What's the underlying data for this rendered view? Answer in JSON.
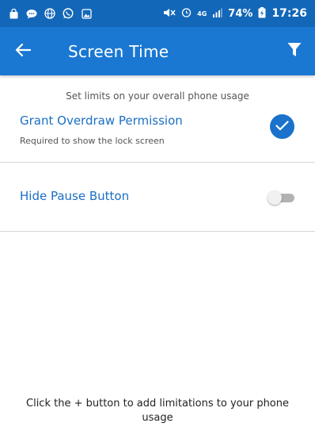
{
  "status_bar": {
    "battery_percent": "74%",
    "time": "17:26",
    "network": "4G",
    "left_icons": [
      "shopping-bag-icon",
      "message-icon",
      "globe-icon",
      "whatsapp-icon",
      "gallery-icon"
    ],
    "right_icons": [
      "mute-icon",
      "alarm-icon",
      "network-4g-icon",
      "signal-icon",
      "battery-charging-icon"
    ]
  },
  "app_bar": {
    "title": "Screen Time",
    "color": "#1a78d2",
    "left_icon": "back-arrow-icon",
    "right_icon": "filter-icon"
  },
  "settings": {
    "subtitle": "Set limits on your overall phone usage",
    "items": [
      {
        "title": "Grant Overdraw Permission",
        "subtitle": "Required to show the lock screen",
        "control": "check-icon",
        "checked": true
      },
      {
        "title": "Hide Pause Button",
        "control": "toggle",
        "on": false
      }
    ]
  },
  "footer": {
    "message": "Click the + button to add limitations to your phone usage"
  },
  "colors": {
    "status_bar": "#1367b8",
    "accent": "#1a72cc",
    "title_text": "#1a6fc4"
  }
}
